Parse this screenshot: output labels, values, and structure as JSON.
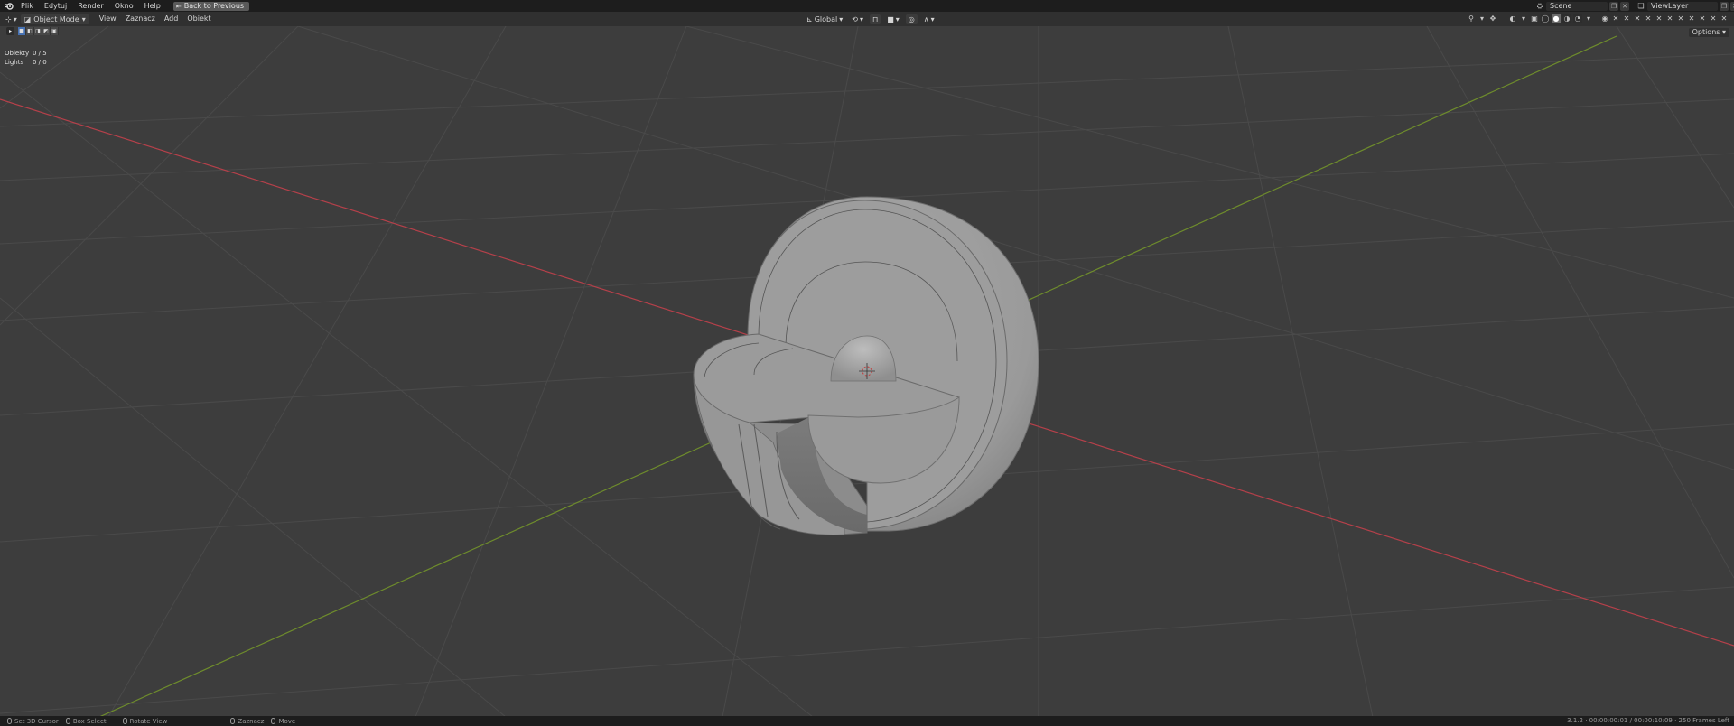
{
  "topbar": {
    "menus": [
      "Plik",
      "Edytuj",
      "Render",
      "Okno",
      "Help"
    ],
    "back_button": "Back to Previous",
    "scene_label": "Scene",
    "viewlayer_label": "ViewLayer"
  },
  "header": {
    "mode": "Object Mode",
    "menus": [
      "View",
      "Zaznacz",
      "Add",
      "Obiekt"
    ],
    "transform_orientation": "Global",
    "options_label": "Options"
  },
  "stats": {
    "objects_label": "Obiekty",
    "objects_value": "0 / 5",
    "lights_label": "Lights",
    "lights_value": "0 / 0"
  },
  "statusbar": {
    "items": [
      "Set 3D Cursor",
      "Box Select",
      "Rotate View",
      "Zaznacz",
      "Move"
    ],
    "version": "3.1.2 · 00:00:00:01 / 00:00:10:09 · 250 Frames Left"
  },
  "colors": {
    "x_axis": "#b5404a",
    "y_axis": "#6e8c2c",
    "accent": "#4772b3",
    "viewport_bg": "#3d3d3d"
  },
  "icons": {
    "logo": "blender-logo-icon",
    "back": "back-arrow-icon",
    "cursor": "3d-cursor-icon"
  }
}
